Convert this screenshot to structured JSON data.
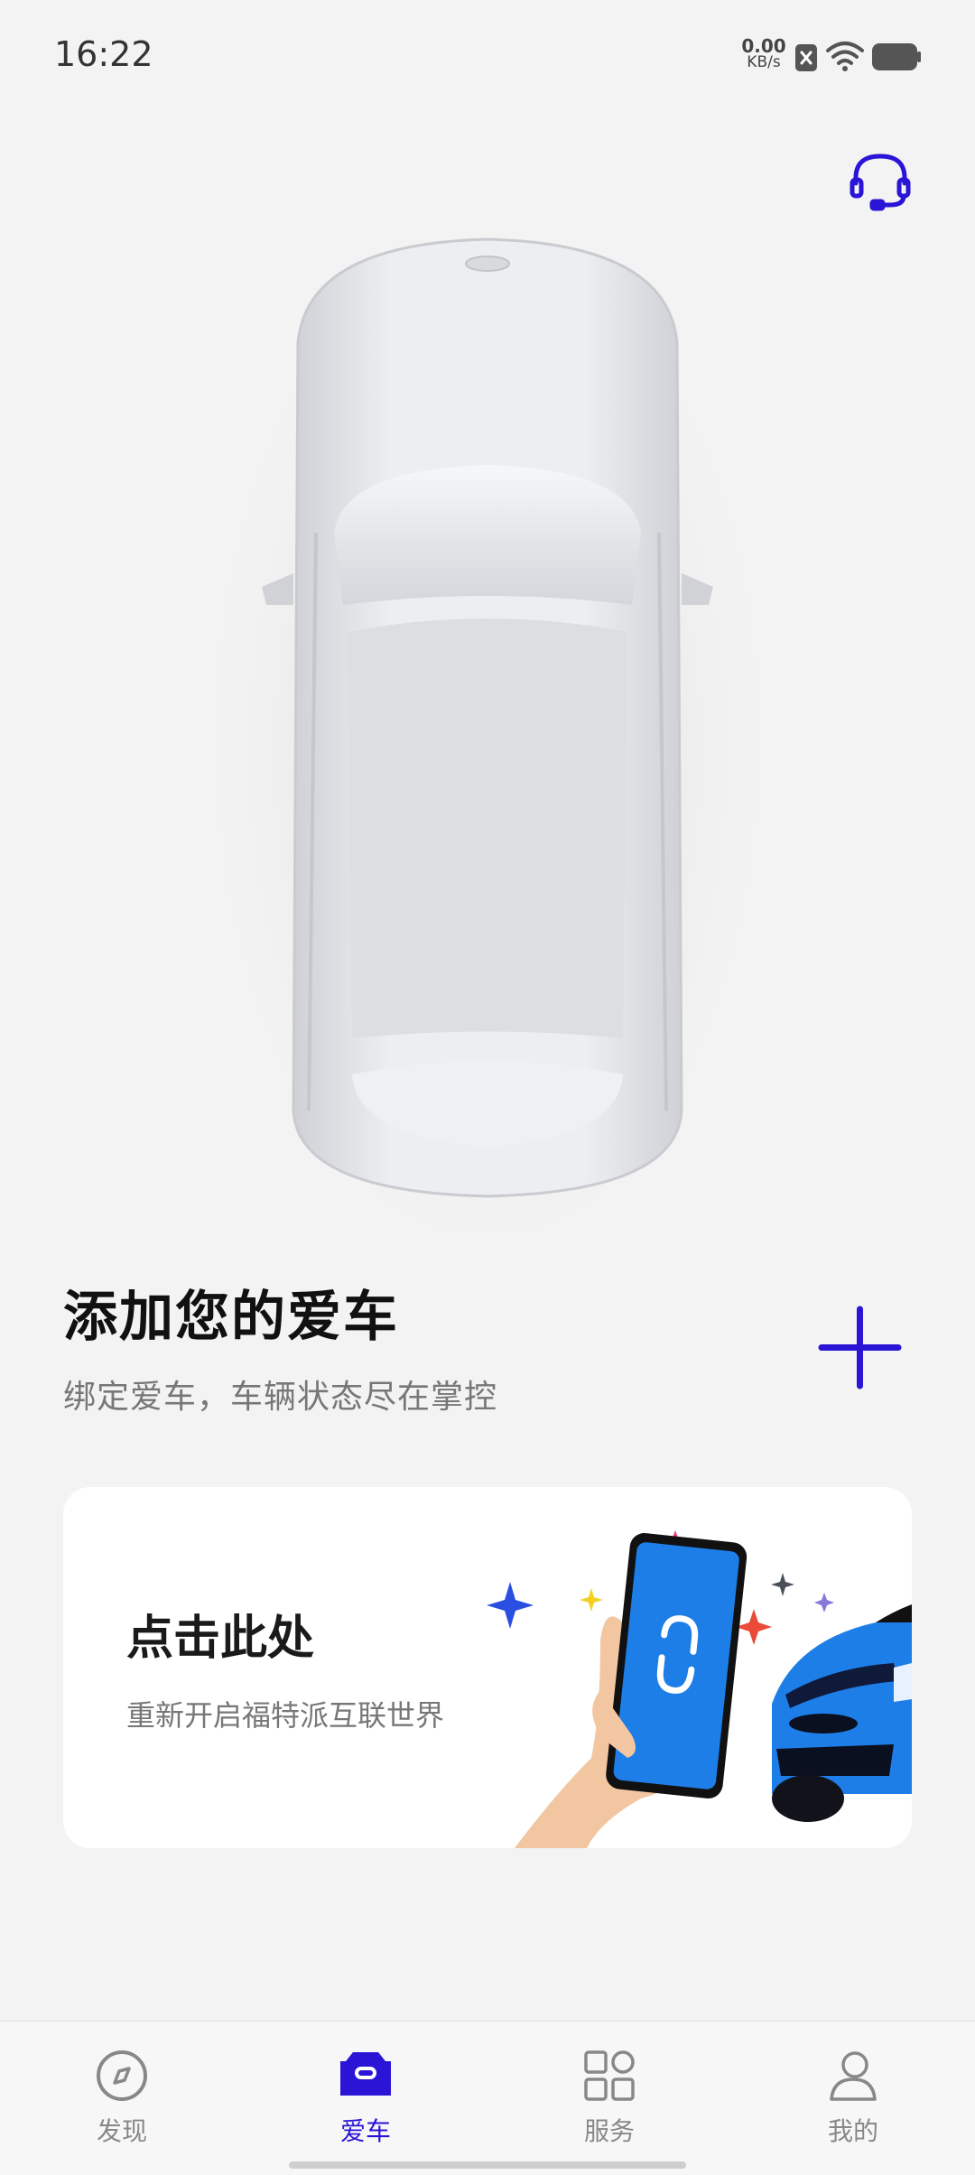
{
  "status_bar": {
    "time": "16:22",
    "net_speed_value": "0.00",
    "net_speed_unit": "KB/s",
    "icons": [
      "notification-x-icon",
      "wifi-icon",
      "battery-icon"
    ]
  },
  "header": {
    "support_icon": "headset-icon"
  },
  "main": {
    "title": "添加您的爱车",
    "subtitle": "绑定爱车，车辆状态尽在掌控",
    "add_icon": "plus-icon"
  },
  "promo": {
    "title": "点击此处",
    "subtitle": "重新开启福特派互联世界"
  },
  "nav": {
    "items": [
      {
        "label": "发现",
        "icon": "compass-icon",
        "active": false
      },
      {
        "label": "爱车",
        "icon": "car-icon",
        "active": true
      },
      {
        "label": "服务",
        "icon": "grid-icon",
        "active": false
      },
      {
        "label": "我的",
        "icon": "person-icon",
        "active": false
      }
    ]
  },
  "colors": {
    "accent": "#2a14d6",
    "background": "#f3f3f3",
    "car_blue": "#1e7ee8"
  }
}
